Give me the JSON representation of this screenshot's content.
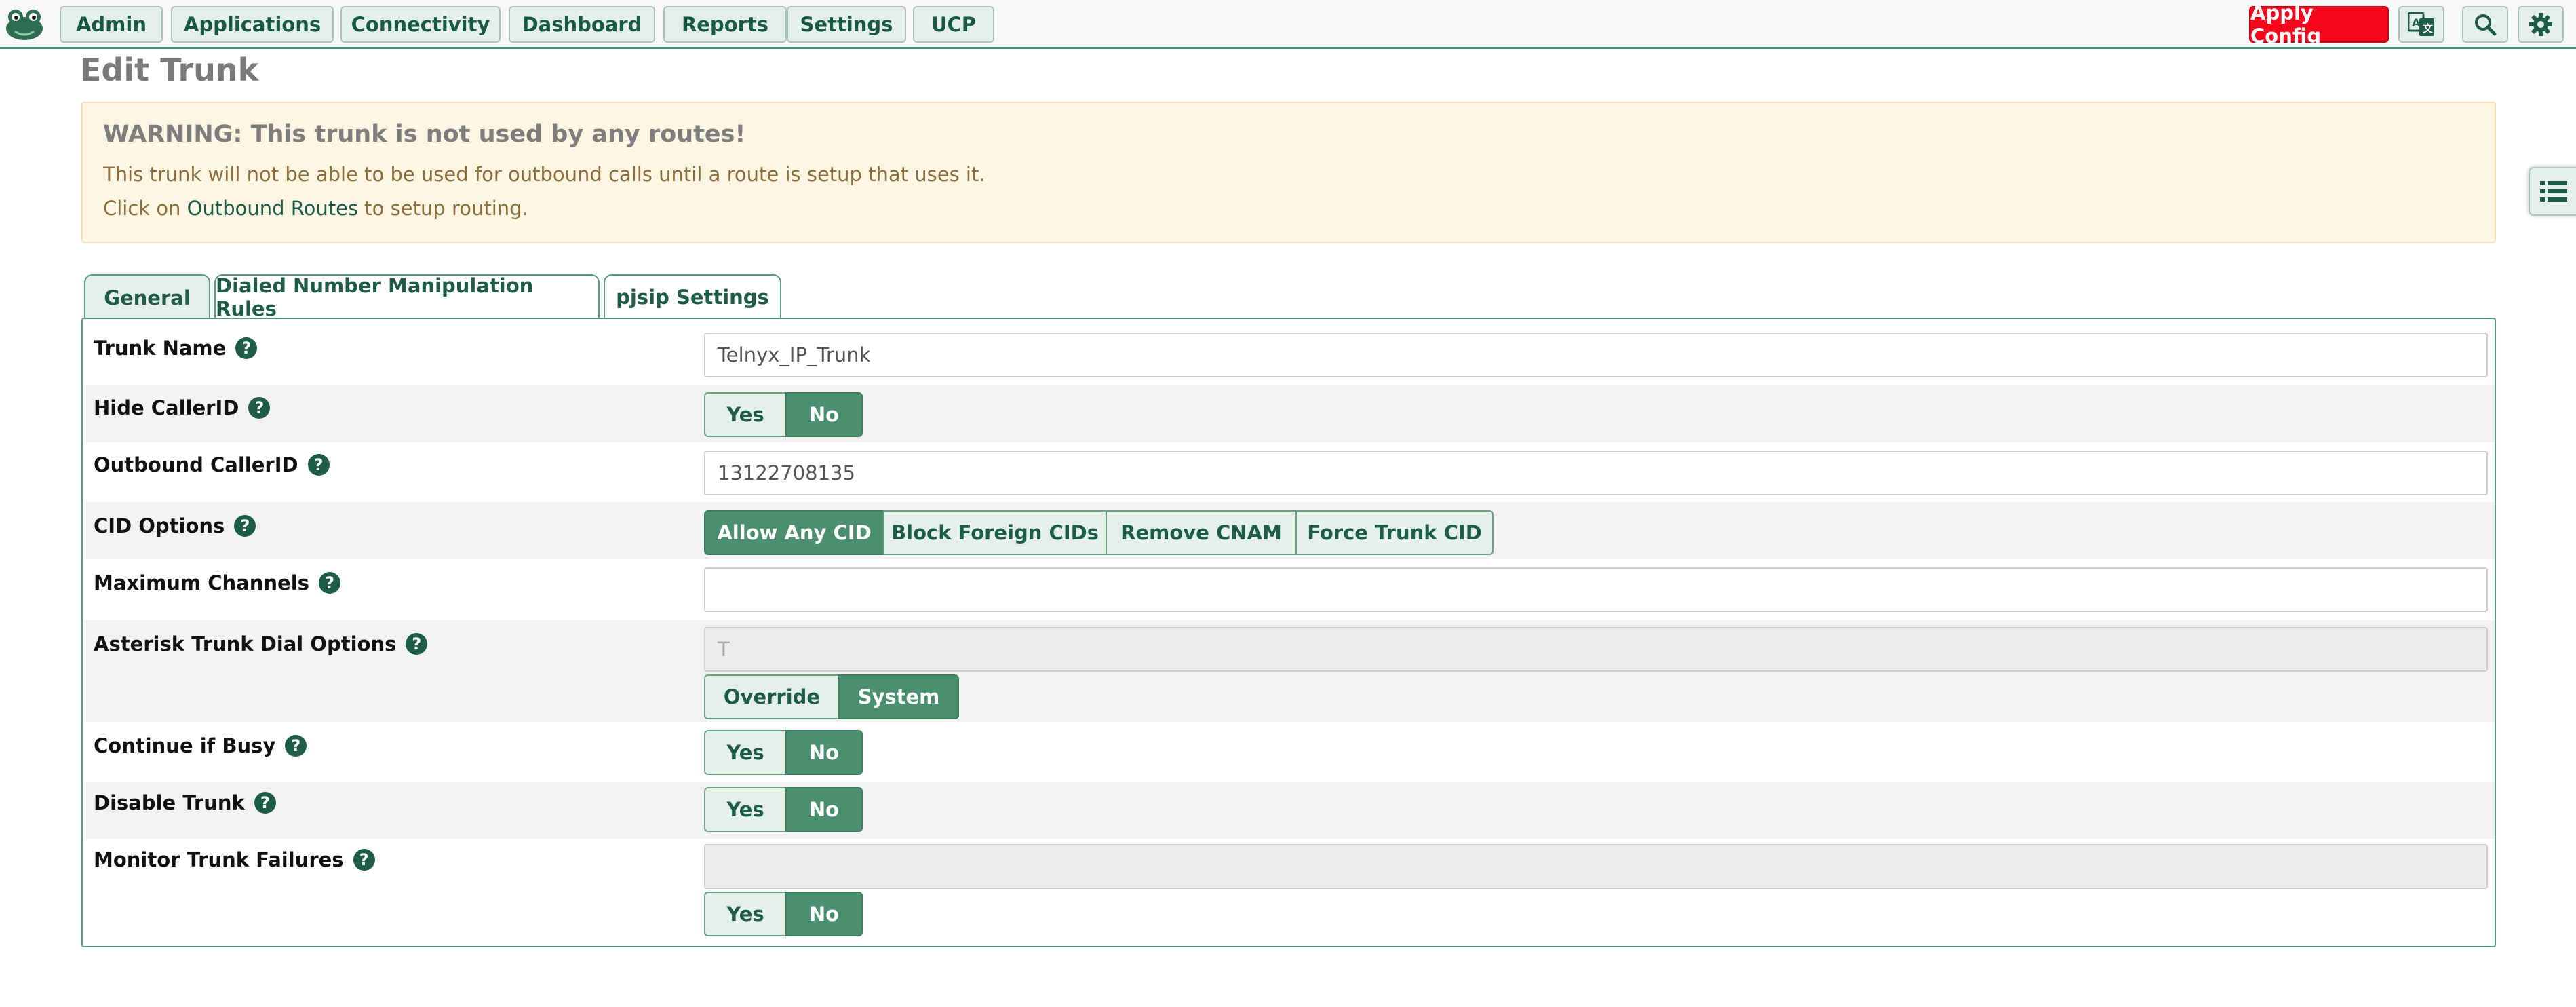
{
  "nav": {
    "items": [
      "Admin",
      "Applications",
      "Connectivity",
      "Dashboard",
      "Reports",
      "Settings",
      "UCP"
    ],
    "apply_label": "Apply Config"
  },
  "page": {
    "title": "Edit Trunk"
  },
  "warning": {
    "title": "WARNING: This trunk is not used by any routes!",
    "line1": "This trunk will not be able to be used for outbound calls until a route is setup that uses it.",
    "line2_prefix": "Click on ",
    "line2_link": "Outbound Routes",
    "line2_suffix": " to setup routing."
  },
  "tabs": [
    "General",
    "Dialed Number Manipulation Rules",
    "pjsip Settings"
  ],
  "form": {
    "trunk_name": {
      "label": "Trunk Name",
      "value": "Telnyx_IP_Trunk"
    },
    "hide_callerid": {
      "label": "Hide CallerID",
      "options": [
        "Yes",
        "No"
      ],
      "selected": "No"
    },
    "outbound_callerid": {
      "label": "Outbound CallerID",
      "value": "13122708135"
    },
    "cid_options": {
      "label": "CID Options",
      "options": [
        "Allow Any CID",
        "Block Foreign CIDs",
        "Remove CNAM",
        "Force Trunk CID"
      ],
      "selected": "Allow Any CID"
    },
    "max_channels": {
      "label": "Maximum Channels",
      "value": ""
    },
    "dial_options": {
      "label": "Asterisk Trunk Dial Options",
      "value": "T",
      "options": [
        "Override",
        "System"
      ],
      "selected": "System"
    },
    "continue_busy": {
      "label": "Continue if Busy",
      "options": [
        "Yes",
        "No"
      ],
      "selected": "No"
    },
    "disable_trunk": {
      "label": "Disable Trunk",
      "options": [
        "Yes",
        "No"
      ],
      "selected": "No"
    },
    "monitor_failures": {
      "label": "Monitor Trunk Failures",
      "value": "",
      "options": [
        "Yes",
        "No"
      ],
      "selected": "No"
    }
  },
  "help_glyph": "?",
  "colors": {
    "accent": "#4a8f70",
    "apply": "#f5061c",
    "warning_bg": "#fdf6e3",
    "help": "#1c5c49"
  },
  "icons": [
    "frog-logo-icon",
    "translate-icon",
    "search-icon",
    "gear-icon",
    "list-icon",
    "help-icon"
  ]
}
